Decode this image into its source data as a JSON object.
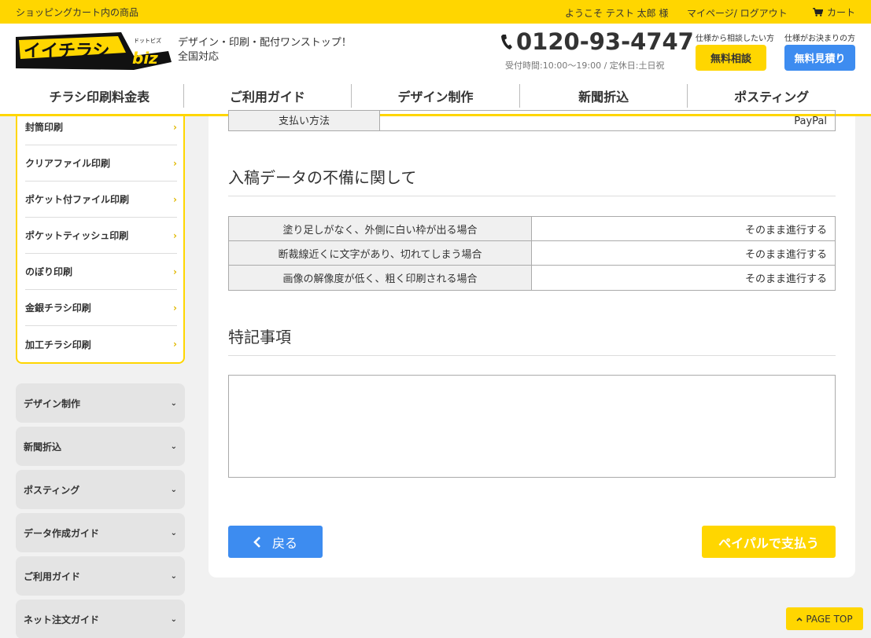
{
  "topbar": {
    "cart_items_label": "ショッピングカート内の商品",
    "welcome": "ようこそ テスト 太郎 様",
    "mypage_logout": "マイページ/ ログアウト",
    "cart_label": "カート"
  },
  "header": {
    "logo_text": "イイチラシ",
    "logo_sub": "ドットビズ",
    "logo_biz": "biz",
    "tagline_line1": "デザイン・印刷・配付ワンストップ！",
    "tagline_line2": "全国対応",
    "phone": "0120-93-4747",
    "hours": "受付時間:10:00〜19:00 / 定休日:土日祝",
    "consult_caption": "仕様から相談したい方",
    "consult_button": "無料相談",
    "estimate_caption": "仕様がお決まりの方",
    "estimate_button": "無料見積り"
  },
  "nav": [
    {
      "label": "チラシ印刷料金表"
    },
    {
      "label": "ご利用ガイド"
    },
    {
      "label": "デザイン制作"
    },
    {
      "label": "新聞折込"
    },
    {
      "label": "ポスティング"
    }
  ],
  "sidebar": {
    "categories": [
      {
        "label": "封筒印刷"
      },
      {
        "label": "クリアファイル印刷"
      },
      {
        "label": "ポケット付ファイル印刷"
      },
      {
        "label": "ポケットティッシュ印刷"
      },
      {
        "label": "のぼり印刷"
      },
      {
        "label": "金銀チラシ印刷"
      },
      {
        "label": "加工チラシ印刷"
      }
    ],
    "accordions": [
      {
        "label": "デザイン制作"
      },
      {
        "label": "新聞折込"
      },
      {
        "label": "ポスティング"
      },
      {
        "label": "データ作成ガイド"
      },
      {
        "label": "ご利用ガイド"
      },
      {
        "label": "ネット注文ガイド"
      }
    ]
  },
  "main": {
    "payment": {
      "label": "支払い方法",
      "value": "PayPal"
    },
    "data_issue_title": "入稿データの不備に関して",
    "data_issue_rows": [
      {
        "label": "塗り足しがなく、外側に白い枠が出る場合",
        "value": "そのまま進行する"
      },
      {
        "label": "断裁線近くに文字があり、切れてしまう場合",
        "value": "そのまま進行する"
      },
      {
        "label": "画像の解像度が低く、粗く印刷される場合",
        "value": "そのまま進行する"
      }
    ],
    "notes_title": "特記事項",
    "notes_value": "",
    "back_button": "戻る",
    "paypal_button": "ペイパルで支払う"
  },
  "page_top": "PAGE TOP",
  "colors": {
    "accent_yellow": "#ffd600",
    "accent_blue": "#3d8cf0"
  }
}
